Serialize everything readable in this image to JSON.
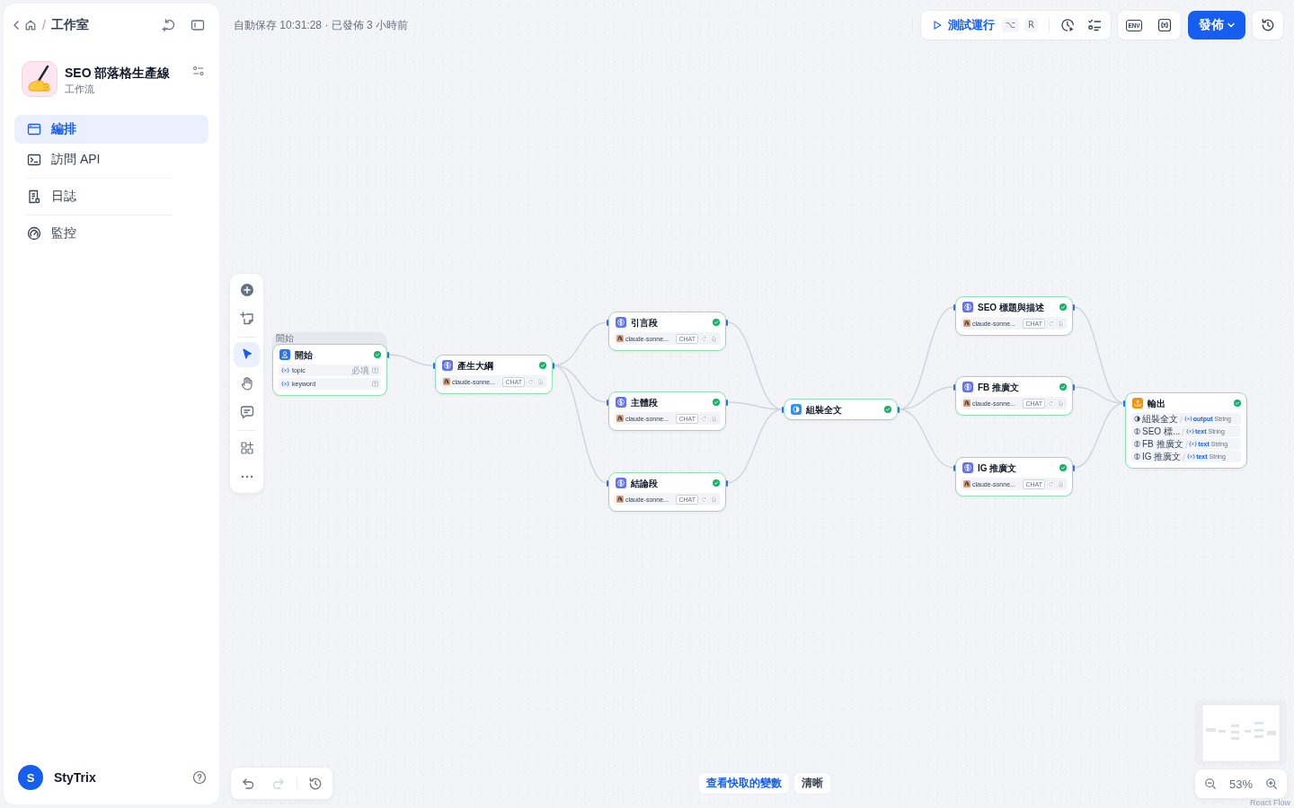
{
  "sidebar": {
    "breadcrumb": {
      "separator": "/",
      "current": "工作室"
    },
    "app": {
      "name": "SEO 部落格生產線",
      "type": "工作流"
    },
    "nav": [
      {
        "label": "編排",
        "selected": true
      },
      {
        "label": "訪問 API",
        "selected": false
      },
      {
        "label": "日誌",
        "selected": false
      },
      {
        "label": "監控",
        "selected": false
      }
    ],
    "user": {
      "initial": "S",
      "name": "StyTrix"
    }
  },
  "header": {
    "autosave": "自動保存 10:31:28 · 已發佈 3 小時前",
    "test_run": {
      "label": "測試運行",
      "keys": [
        "⌥",
        "R"
      ]
    },
    "env": "ENV",
    "publish": "發佈"
  },
  "canvas_toolbar": {
    "modes": [
      {
        "selected": true
      },
      {
        "selected": false
      }
    ]
  },
  "canvas": {
    "nodes": [
      {
        "kind": "start",
        "group_label": "開始",
        "title": "開始",
        "succeeded": true,
        "variables": [
          {
            "name": "topic",
            "tag": "必填"
          },
          {
            "name": "keyword"
          }
        ]
      },
      {
        "kind": "llm",
        "title": "產生大綱",
        "succeeded": true,
        "model": "claude-sonne...",
        "mode": "CHAT"
      },
      {
        "kind": "llm",
        "title": "引言段",
        "succeeded": true,
        "model": "claude-sonne...",
        "mode": "CHAT"
      },
      {
        "kind": "llm",
        "title": "主體段",
        "succeeded": true,
        "model": "claude-sonne...",
        "mode": "CHAT"
      },
      {
        "kind": "llm",
        "title": "結論段",
        "succeeded": true,
        "model": "claude-sonne...",
        "mode": "CHAT"
      },
      {
        "kind": "template",
        "title": "組裝全文",
        "succeeded": true
      },
      {
        "kind": "llm",
        "title": "SEO 標題與描述",
        "succeeded": true,
        "model": "claude-sonne...",
        "mode": "CHAT"
      },
      {
        "kind": "llm",
        "title": "FB 推廣文",
        "succeeded": true,
        "model": "claude-sonne...",
        "mode": "CHAT"
      },
      {
        "kind": "llm",
        "title": "IG 推廣文",
        "succeeded": true,
        "model": "claude-sonne...",
        "mode": "CHAT"
      },
      {
        "kind": "end",
        "title": "輸出",
        "succeeded": true,
        "outputs": [
          {
            "kind": "template",
            "source": "組裝全文",
            "variable": "output",
            "type": "String"
          },
          {
            "kind": "llm",
            "source": "SEO 標...",
            "variable": "text",
            "type": "String"
          },
          {
            "kind": "llm",
            "source": "FB 推廣文",
            "variable": "text",
            "type": "String"
          },
          {
            "kind": "llm",
            "source": "IG 推廣文",
            "variable": "text",
            "type": "String"
          }
        ]
      }
    ]
  },
  "history_controls": [
    {
      "disabled": false
    },
    {
      "disabled": true
    }
  ],
  "variable_actions": {
    "view_cache": "查看快取的變數",
    "clear": "清晰"
  },
  "zoom": {
    "value": "53%"
  },
  "attribution": "React Flow"
}
